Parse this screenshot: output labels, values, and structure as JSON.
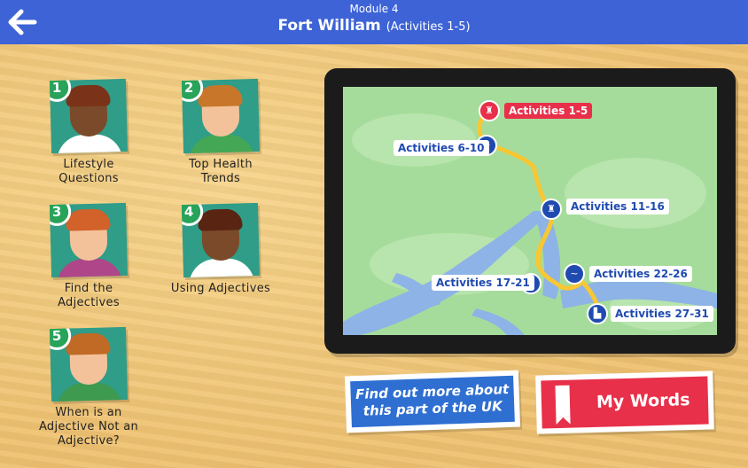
{
  "header": {
    "module": "Module 4",
    "title": "Fort William",
    "subtitle": "(Activities 1-5)",
    "back_icon": "back-arrow-icon"
  },
  "activities": [
    {
      "number": "1",
      "label_line1": "Lifestyle",
      "label_line2": "Questions",
      "label_line3": "",
      "skin": "#7b4a2a",
      "hair": "#7a3318",
      "shirt": "#ffffff"
    },
    {
      "number": "2",
      "label_line1": "Top Health",
      "label_line2": "Trends",
      "label_line3": "",
      "skin": "#f3c29a",
      "hair": "#c8762a",
      "shirt": "#44a755"
    },
    {
      "number": "3",
      "label_line1": "Find the",
      "label_line2": "Adjectives",
      "label_line3": "",
      "skin": "#f3c29a",
      "hair": "#d2612a",
      "shirt": "#b0468a"
    },
    {
      "number": "4",
      "label_line1": "Using Adjectives",
      "label_line2": "",
      "label_line3": "",
      "skin": "#7b4a2a",
      "hair": "#5a2412",
      "shirt": "#ffffff"
    },
    {
      "number": "5",
      "label_line1": "When is an",
      "label_line2": "Adjective Not an",
      "label_line3": "Adjective?",
      "skin": "#f3c29a",
      "hair": "#c06a25",
      "shirt": "#3e9a4f"
    }
  ],
  "map": {
    "pins": [
      {
        "label": "Activities 1-5",
        "active": true
      },
      {
        "label": "Activities 6-10",
        "active": false
      },
      {
        "label": "Activities 11-16",
        "active": false
      },
      {
        "label": "Activities 22-26",
        "active": false
      },
      {
        "label": "Activities 17-21",
        "active": false
      },
      {
        "label": "Activities 27-31",
        "active": false
      }
    ]
  },
  "buttons": {
    "find_out_line1": "Find out more about",
    "find_out_line2": "this part of the UK",
    "my_words": "My Words",
    "my_words_icon": "bookmark-icon"
  },
  "colors": {
    "header": "#3d63d6",
    "badge": "#27a35a",
    "pin_blue": "#1f4bb0",
    "pin_red": "#e8304a",
    "map_land": "#a6dc9b",
    "map_water": "#8eb3e6"
  }
}
